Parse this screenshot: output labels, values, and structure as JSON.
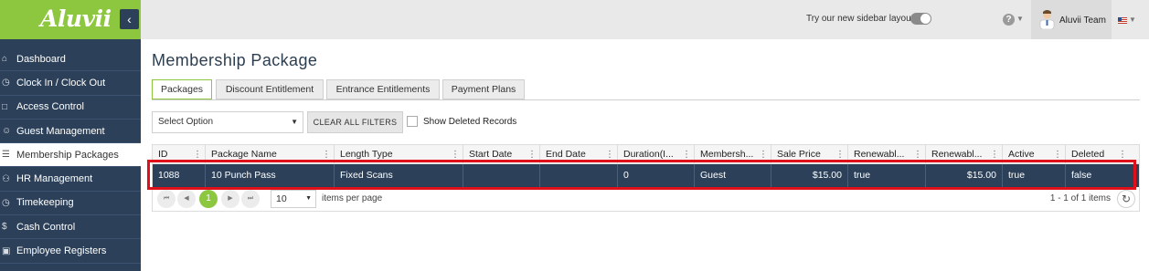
{
  "app": {
    "logo": "Aluvii",
    "collapse_icon": "chevron-left-icon"
  },
  "sidebar": {
    "items": [
      {
        "label": "Dashboard",
        "icon": "home-icon",
        "active": false
      },
      {
        "label": "Clock In / Clock Out",
        "icon": "clock-icon",
        "active": false
      },
      {
        "label": "Access Control",
        "icon": "lock-icon",
        "active": false
      },
      {
        "label": "Guest Management",
        "icon": "user-icon",
        "active": false
      },
      {
        "label": "Membership Packages",
        "icon": "list-icon",
        "active": true
      },
      {
        "label": "HR Management",
        "icon": "people-icon",
        "active": false
      },
      {
        "label": "Timekeeping",
        "icon": "timer-icon",
        "active": false
      },
      {
        "label": "Cash Control",
        "icon": "dollar-icon",
        "active": false
      },
      {
        "label": "Employee Registers",
        "icon": "cart-icon",
        "active": false
      }
    ]
  },
  "topbar": {
    "sidebar_layout_label": "Try our new sidebar layout",
    "user_name": "Aluvii Team"
  },
  "main": {
    "title": "Membership Package",
    "tabs": [
      {
        "label": "Packages",
        "active": true
      },
      {
        "label": "Discount Entitlement",
        "active": false
      },
      {
        "label": "Entrance Entitlements",
        "active": false
      },
      {
        "label": "Payment Plans",
        "active": false
      }
    ],
    "filters": {
      "select_placeholder": "Select Option",
      "clear_label": "CLEAR ALL FILTERS",
      "show_deleted_label": "Show Deleted Records",
      "show_deleted_checked": false
    },
    "table": {
      "columns": [
        "ID",
        "Package Name",
        "Length Type",
        "Start Date",
        "End Date",
        "Duration(I...",
        "Membersh...",
        "Sale Price",
        "Renewabl...",
        "Renewabl...",
        "Active",
        "Deleted"
      ],
      "rows": [
        [
          "1088",
          "10 Punch Pass",
          "Fixed Scans",
          "",
          "",
          "0",
          "Guest",
          "$15.00",
          "true",
          "$15.00",
          "true",
          "false"
        ]
      ]
    },
    "pager": {
      "current_page": "1",
      "per_page": "10",
      "per_page_label": "items per page",
      "items_info": "1 - 1 of 1 items"
    }
  },
  "colors": {
    "accent": "#8dc63f",
    "sidebar": "#2c4159",
    "highlight": "#e0101a"
  }
}
